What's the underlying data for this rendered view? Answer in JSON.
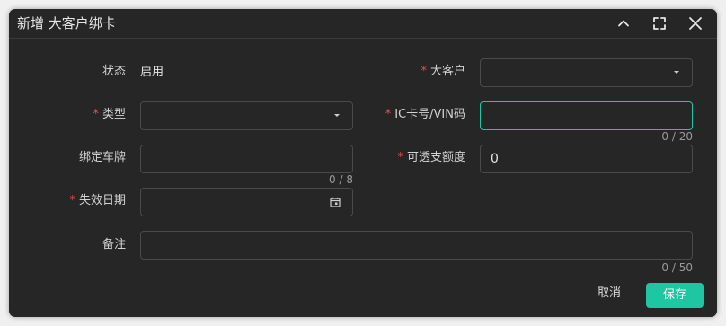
{
  "dialog": {
    "title": "新增 大客户绑卡",
    "header_icons": [
      "chevron-up-icon",
      "fullscreen-icon",
      "close-icon"
    ]
  },
  "form": {
    "status": {
      "label": "状态",
      "value": "启用"
    },
    "customer": {
      "label": "大客户",
      "required": true,
      "value": ""
    },
    "type": {
      "label": "类型",
      "required": true,
      "value": ""
    },
    "ic_card": {
      "label": "IC卡号/VIN码",
      "required": true,
      "value": "",
      "counter": "0 / 20"
    },
    "plate": {
      "label": "绑定车牌",
      "value": "",
      "counter": "0 / 8"
    },
    "overdraft": {
      "label": "可透支额度",
      "required": true,
      "value": "0"
    },
    "expiry": {
      "label": "失效日期",
      "required": true,
      "value": ""
    },
    "remark": {
      "label": "备注",
      "value": "",
      "counter": "0 / 50"
    }
  },
  "footer": {
    "cancel_label": "取消",
    "save_label": "保存"
  },
  "colors": {
    "background": "#262626",
    "accent": "#1fc6a2",
    "required": "#f04a4a",
    "border": "#4a4a4a"
  }
}
